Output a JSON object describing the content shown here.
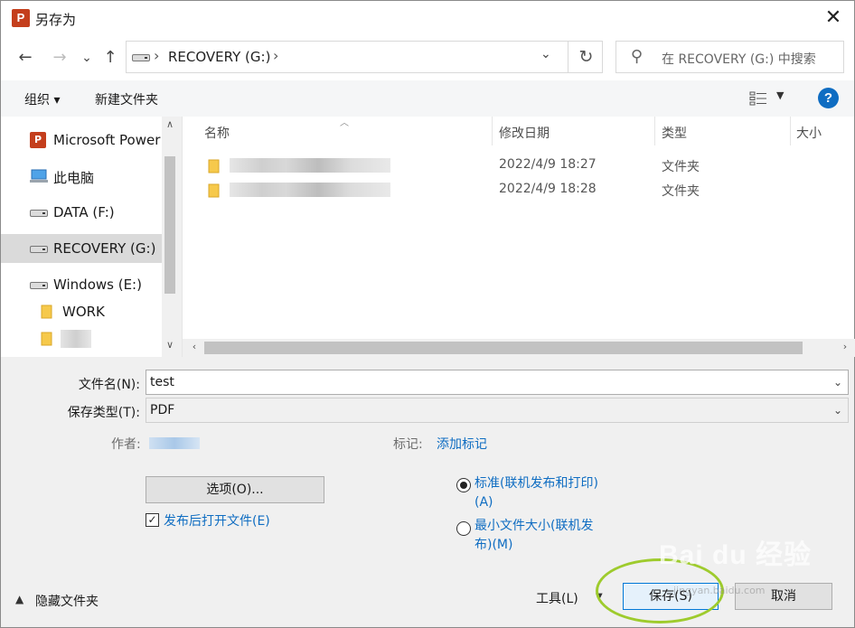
{
  "window": {
    "title": "另存为",
    "app_icon": "powerpoint-icon",
    "close_glyph": "✕"
  },
  "navigation": {
    "back": "←",
    "forward": "→",
    "recent": "⌄",
    "up": "↑",
    "breadcrumb": "RECOVERY (G:)",
    "breadcrumb_sep": "›",
    "dropdown": "⌄",
    "refresh": "↻",
    "search_placeholder": "在 RECOVERY (G:) 中搜索"
  },
  "toolbar": {
    "organize": "组织 ▾",
    "new_folder": "新建文件夹",
    "help": "?"
  },
  "nav_pane": {
    "items": [
      {
        "label": "Microsoft Power",
        "icon": "powerpoint-icon"
      },
      {
        "label": "此电脑",
        "icon": "computer-icon"
      },
      {
        "label": "DATA (F:)",
        "icon": "drive-icon"
      },
      {
        "label": "RECOVERY (G:)",
        "icon": "drive-icon",
        "selected": true
      },
      {
        "label": "Windows (E:)",
        "icon": "drive-icon"
      },
      {
        "label": "WORK",
        "icon": "folder-icon"
      }
    ]
  },
  "file_list": {
    "columns": [
      "名称",
      "修改日期",
      "类型",
      "大小"
    ],
    "rows": [
      {
        "date": "2022/4/9 18:27",
        "type": "文件夹"
      },
      {
        "date": "2022/4/9 18:28",
        "type": "文件夹"
      }
    ]
  },
  "form": {
    "filename_label": "文件名(N):",
    "filename_value": "test",
    "filetype_label": "保存类型(T):",
    "filetype_value": "PDF",
    "author_label": "作者:",
    "tags_label": "标记:",
    "tags_link": "添加标记",
    "options_button": "选项(O)...",
    "open_after_publish": "发布后打开文件(E)",
    "open_after_publish_checked": true,
    "opt_standard_line1": "标准(联机发布和打印)",
    "opt_standard_line2": "(A)",
    "opt_min_line1": "最小文件大小(联机发",
    "opt_min_line2": "布)(M)",
    "standard_selected": true
  },
  "footer": {
    "hide_folders": "隐藏文件夹",
    "tools": "工具(L)",
    "save": "保存(S)",
    "cancel": "取消"
  },
  "watermark": {
    "brand": "Bai du 经验",
    "url": "jingyan.baidu.com"
  },
  "colors": {
    "accent": "#0f6dc2",
    "ppt_red": "#c43e1c",
    "highlight": "#9ecb2d"
  }
}
